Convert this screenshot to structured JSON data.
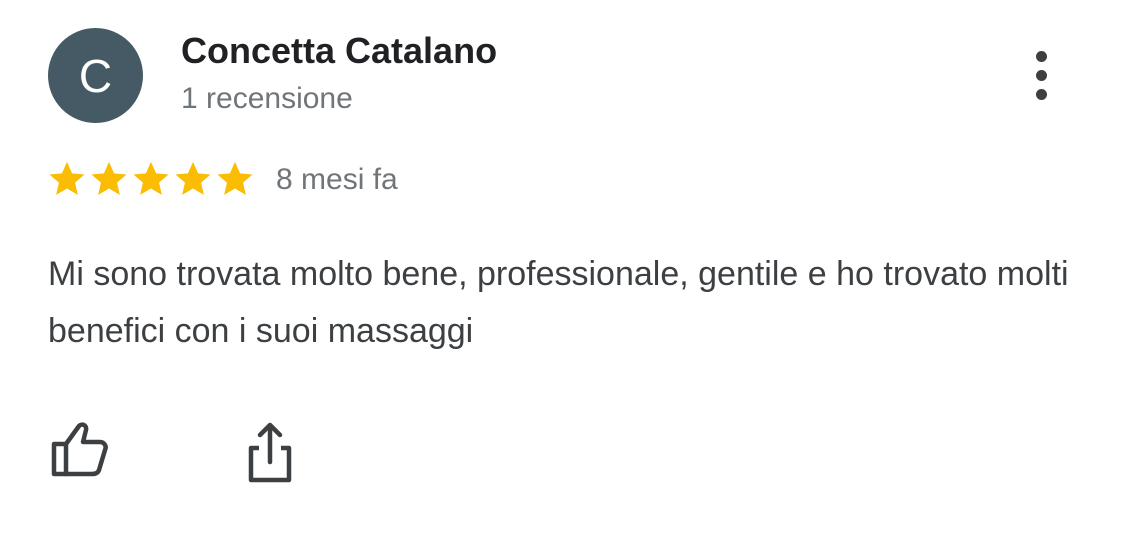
{
  "reviewer": {
    "avatar_initial": "C",
    "avatar_color": "#455a64",
    "name": "Concetta Catalano",
    "review_count": "1 recensione"
  },
  "review": {
    "rating": 5,
    "max_rating": 5,
    "star_color": "#fbbc04",
    "time": "8 mesi fa",
    "text": "Mi sono trovata molto bene, professionale, gentile e ho trovato molti benefici con i suoi massaggi"
  },
  "actions": {
    "menu_icon": "more-vertical-icon",
    "like_icon": "thumb-up-icon",
    "share_icon": "share-icon"
  }
}
